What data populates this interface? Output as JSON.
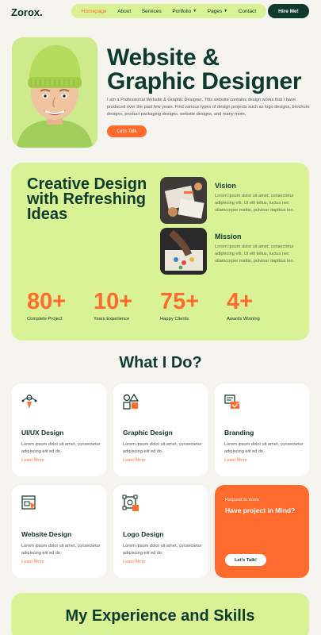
{
  "header": {
    "logo": "Zorox.",
    "nav": [
      {
        "label": "Homepage",
        "active": true,
        "dropdown": false
      },
      {
        "label": "About",
        "active": false,
        "dropdown": false
      },
      {
        "label": "Services",
        "active": false,
        "dropdown": false
      },
      {
        "label": "Portfolio",
        "active": false,
        "dropdown": true
      },
      {
        "label": "Pages",
        "active": false,
        "dropdown": true
      },
      {
        "label": "Contact",
        "active": false,
        "dropdown": false
      }
    ],
    "hire_label": "Hire Me!"
  },
  "hero": {
    "title_line1": "Website &",
    "title_line2": "Graphic Designer",
    "description": "I am a Professional Website & Graphic Designer. This website contains design works that I have produced over the past few years. Find various types of design projects such as logo designs, brochure designs, product packaging designs, website designs, and many more.",
    "cta_label": "Let's Talk"
  },
  "creative": {
    "title": "Creative Design with Refreshing Ideas",
    "features": [
      {
        "title": "Vision",
        "desc": "Lorem ipsum dolor sit amet, consectetur adipiscing elit. Ut elit tellus, luctus nec ullamcorper mattis, pulvinar dapibus leo."
      },
      {
        "title": "Mission",
        "desc": "Lorem ipsum dolor sit amet, consectetur adipiscing elit. Ut elit tellus, luctus nec ullamcorper mattis, pulvinar dapibus leo."
      }
    ],
    "stats": [
      {
        "num": "80+",
        "label": "Complete Project"
      },
      {
        "num": "10+",
        "label": "Years Experience"
      },
      {
        "num": "75+",
        "label": "Happy Clients"
      },
      {
        "num": "4+",
        "label": "Awards Winning"
      }
    ]
  },
  "services": {
    "title": "What I Do?",
    "items": [
      {
        "title": "UI/UX Design",
        "desc": "Lorem ipsum dolor sit amet, consectetur adipiscing elit ed do.",
        "more": "Learn More",
        "icon": "uiux-pen-icon"
      },
      {
        "title": "Graphic Design",
        "desc": "Lorem ipsum dolor sit amet, consectetur adipiscing elit ed do.",
        "more": "Learn More",
        "icon": "shapes-icon"
      },
      {
        "title": "Branding",
        "desc": "Lorem ipsum dolor sit amet, consectetur adipiscing elit ed do.",
        "more": "Learn More",
        "icon": "branding-board-icon"
      },
      {
        "title": "Website Design",
        "desc": "Lorem ipsum dolor sit amet, consectetur adipiscing elit ed do.",
        "more": "Learn More",
        "icon": "web-cursor-icon"
      },
      {
        "title": "Logo Design",
        "desc": "Lorem ipsum dolor sit amet, consectetur adipiscing elit ed do.",
        "more": "Learn More",
        "icon": "logo-vector-icon"
      }
    ],
    "cta": {
      "small": "Request to more",
      "big": "Have project in Mind?",
      "button": "Let's Talk!"
    }
  },
  "experience": {
    "title": "My Experience and Skills"
  },
  "colors": {
    "accent": "#ff6b2c",
    "dark": "#0f3a2e",
    "lime": "#d9f295"
  }
}
